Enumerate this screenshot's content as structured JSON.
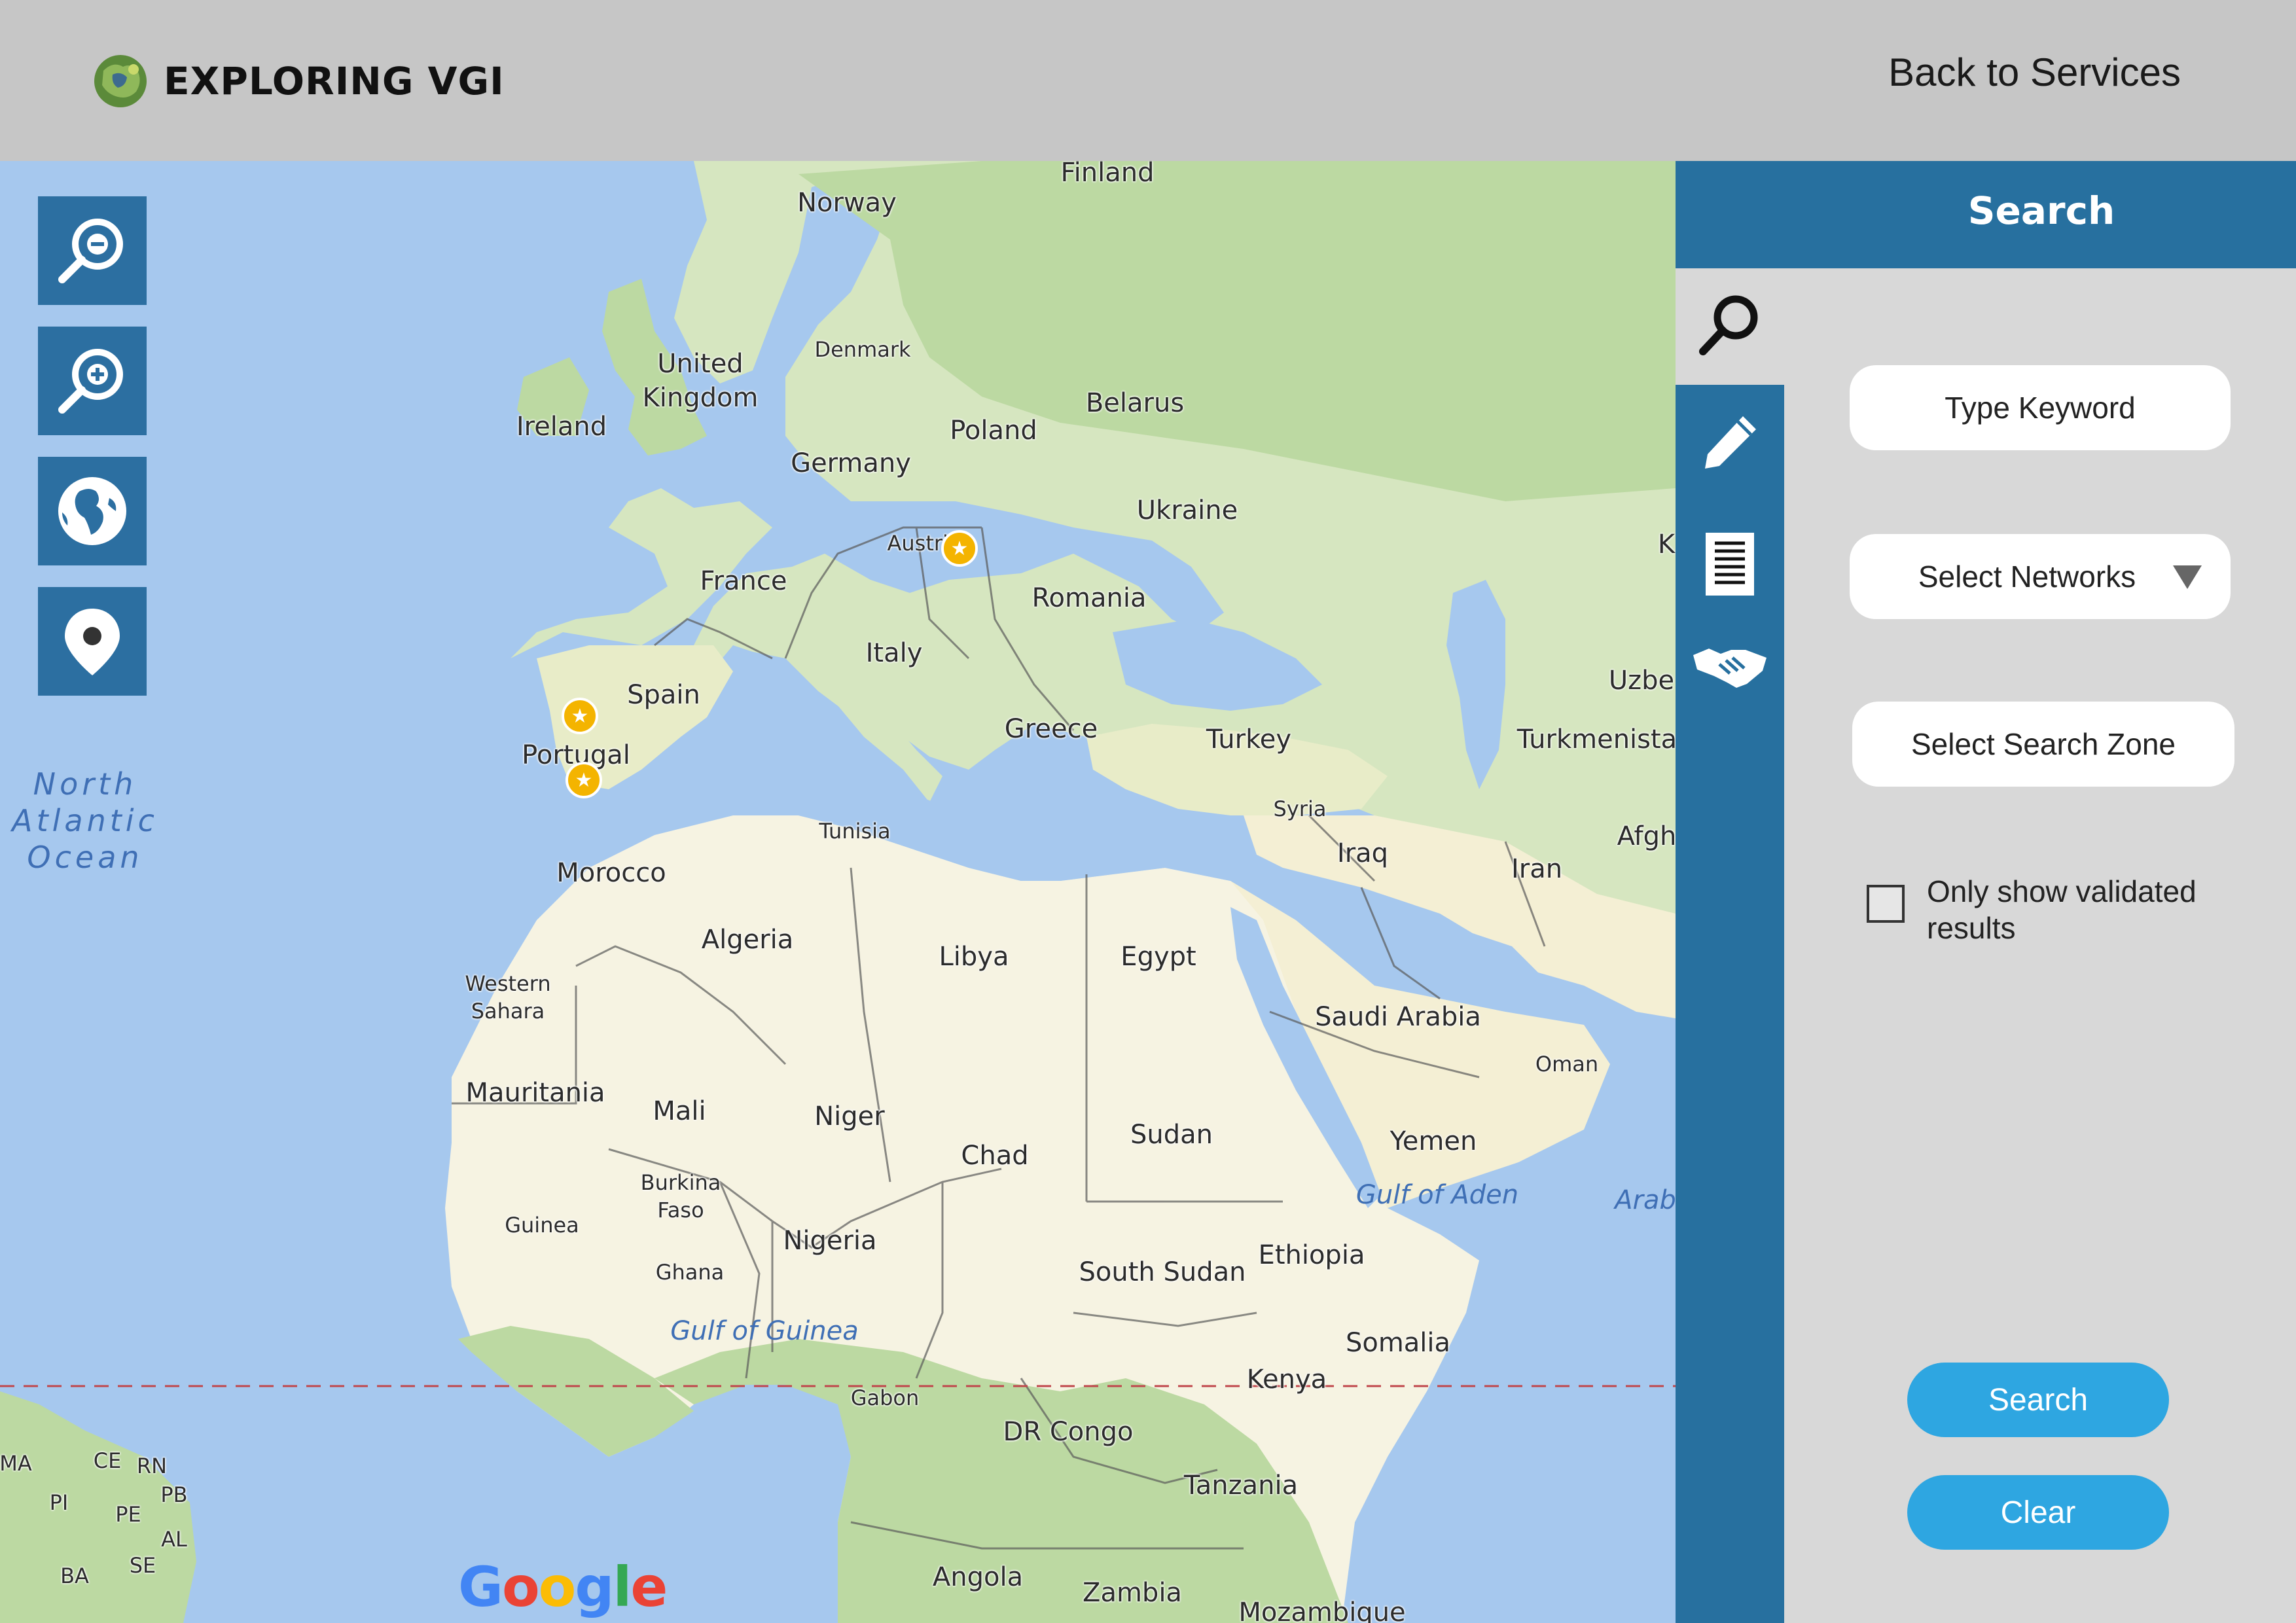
{
  "header": {
    "logo_text": "EXPLORING VGI",
    "back_link": "Back to Services"
  },
  "map": {
    "attribution": "Google",
    "tool_icons": [
      "zoom-out-icon",
      "zoom-in-icon",
      "globe-icon",
      "location-pin-icon"
    ],
    "labels": {
      "finland": "Finland",
      "norway": "Norway",
      "denmark": "Denmark",
      "united_kingdom": "United\nKingdom",
      "ireland": "Ireland",
      "belarus": "Belarus",
      "poland": "Poland",
      "germany": "Germany",
      "ukraine": "Ukraine",
      "austria": "Austria",
      "france": "France",
      "romania": "Romania",
      "italy": "Italy",
      "spain": "Spain",
      "portugal": "Portugal",
      "greece": "Greece",
      "turkey": "Turkey",
      "turkmenistan": "Turkmenista",
      "uzbekistan": "Uzbe",
      "kaz": "K",
      "syria": "Syria",
      "iraq": "Iraq",
      "iran": "Iran",
      "afghanistan": "Afgh",
      "tunisia": "Tunisia",
      "morocco": "Morocco",
      "algeria": "Algeria",
      "libya": "Libya",
      "egypt": "Egypt",
      "western_sahara": "Western\nSahara",
      "saudi_arabia": "Saudi Arabia",
      "oman": "Oman",
      "mauritania": "Mauritania",
      "mali": "Mali",
      "niger": "Niger",
      "chad": "Chad",
      "sudan": "Sudan",
      "yemen": "Yemen",
      "gulf_of_aden": "Gulf of Aden",
      "arabian_sea": "Arab",
      "burkina_faso": "Burkina\nFaso",
      "guinea": "Guinea",
      "nigeria": "Nigeria",
      "ghana": "Ghana",
      "south_sudan": "South Sudan",
      "ethiopia": "Ethiopia",
      "gulf_of_guinea": "Gulf of Guinea",
      "somalia": "Somalia",
      "gabon": "Gabon",
      "kenya": "Kenya",
      "dr_congo": "DR Congo",
      "tanzania": "Tanzania",
      "angola": "Angola",
      "zambia": "Zambia",
      "mozambique": "Mozambique",
      "north_atlantic": "North\nAtlantic\nOcean",
      "ma": "MA",
      "ce": "CE",
      "rn": "RN",
      "pb": "PB",
      "pi": "PI",
      "pe": "PE",
      "al": "AL",
      "ba": "BA",
      "se": "SE"
    }
  },
  "panel": {
    "title": "Search",
    "side_icons": [
      "search-icon",
      "pencil-icon",
      "document-icon",
      "handshake-icon"
    ],
    "keyword_placeholder": "Type Keyword",
    "networks_label": "Select Networks",
    "zone_label": "Select Search Zone",
    "validated_label": "Only show validated results",
    "validated_checked": false,
    "search_button": "Search",
    "clear_button": "Clear"
  },
  "colors": {
    "header_bg": "#c6c6c6",
    "panel_blue": "#27709f",
    "button_blue": "#2ea6e1",
    "water": "#a6c8ee",
    "land": "#f6f3e2",
    "forest": "#c5dfae",
    "pin": "#f4b400"
  }
}
